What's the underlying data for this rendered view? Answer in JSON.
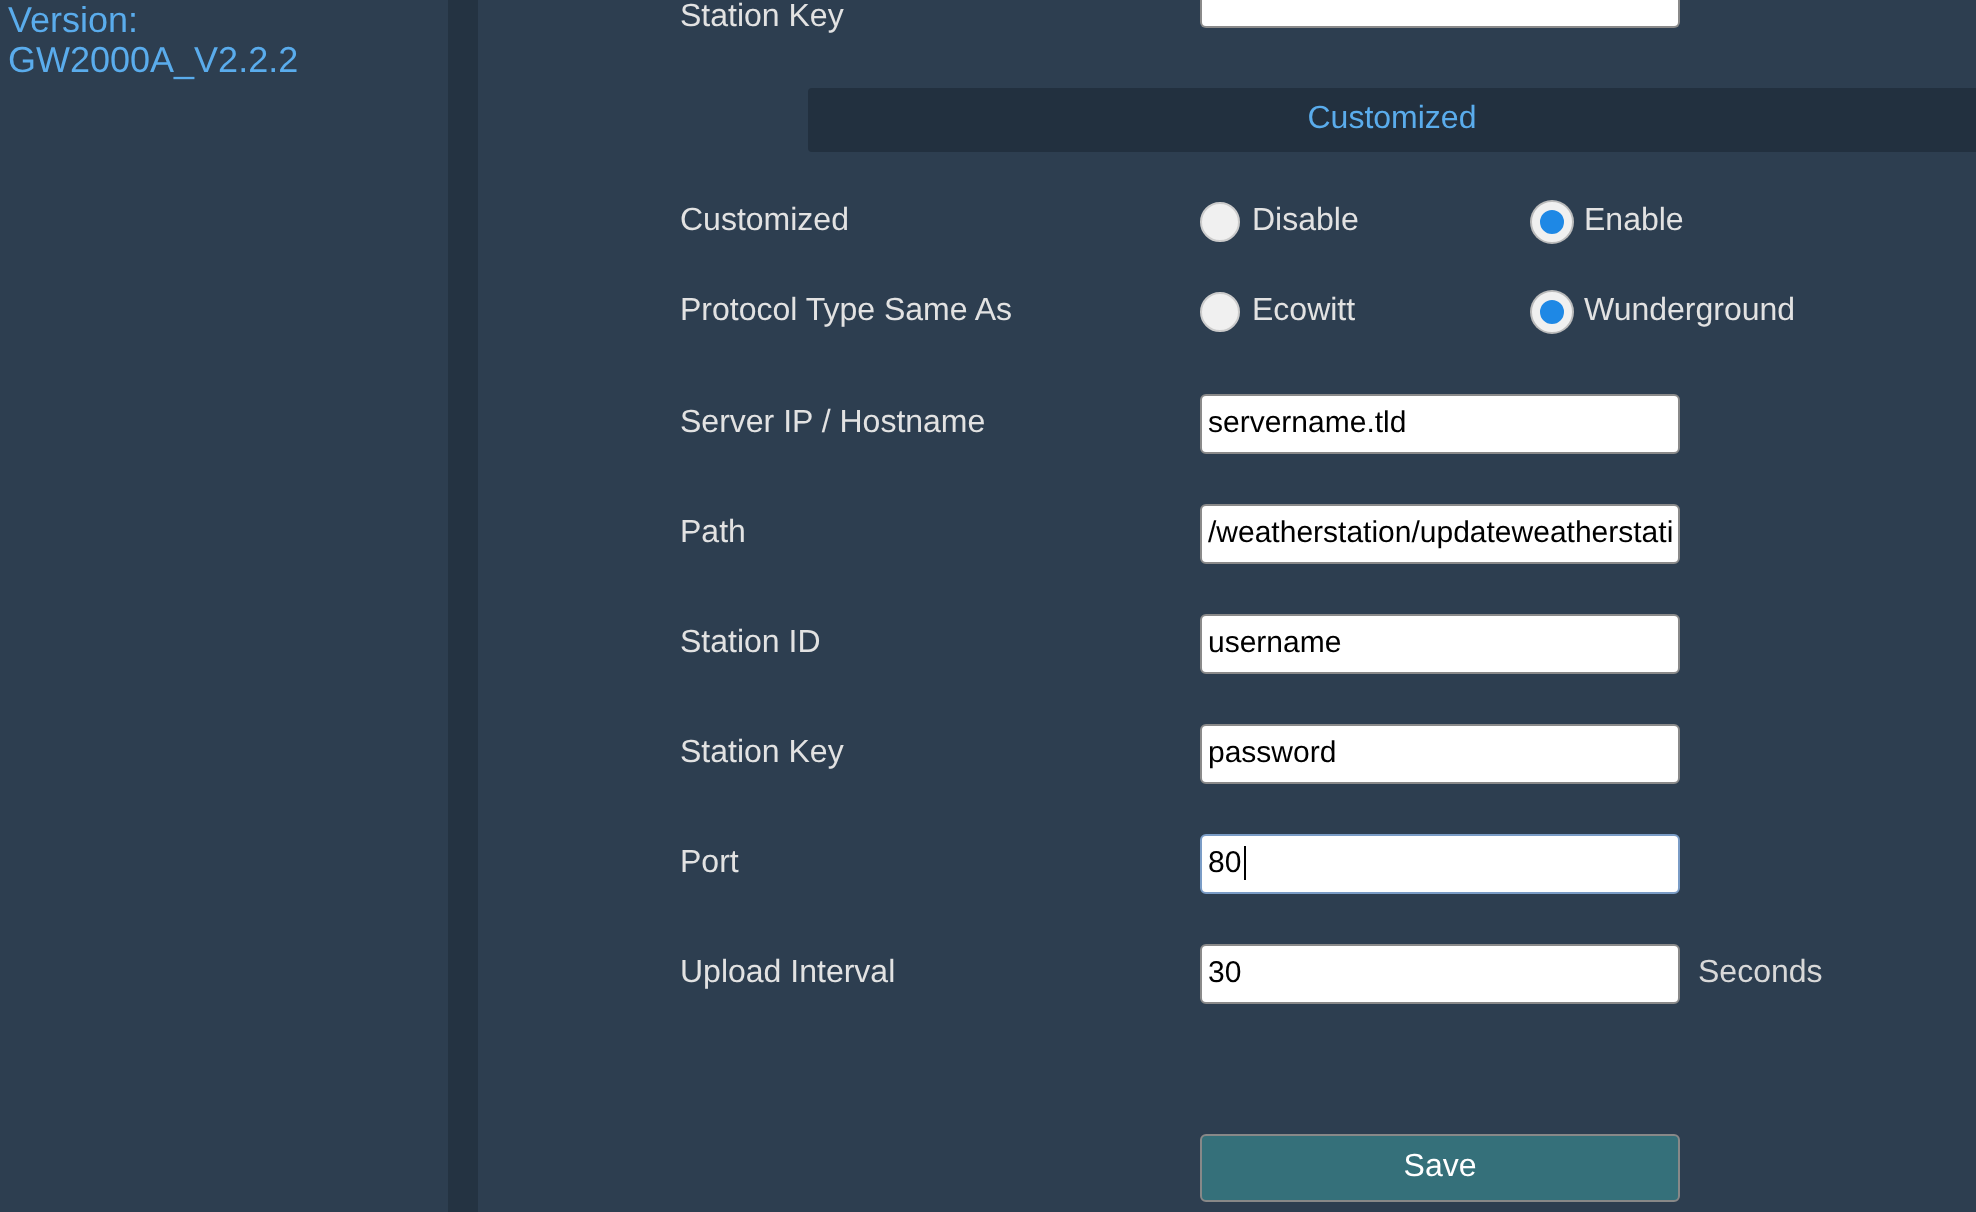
{
  "sidebar": {
    "version_label": "Version:",
    "version_value": "GW2000A_V2.2.2"
  },
  "top_row": {
    "label": "Station Key"
  },
  "section": {
    "title": "Customized"
  },
  "radio_groups": [
    {
      "label": "Customized",
      "options": [
        {
          "label": "Disable",
          "selected": false
        },
        {
          "label": "Enable",
          "selected": true
        }
      ]
    },
    {
      "label": "Protocol Type Same As",
      "options": [
        {
          "label": "Ecowitt",
          "selected": false
        },
        {
          "label": "Wunderground",
          "selected": true
        }
      ]
    }
  ],
  "fields": [
    {
      "label": "Server IP / Hostname",
      "value": "servername.tld",
      "focused": false
    },
    {
      "label": "Path",
      "value": "/weatherstation/updateweatherstati",
      "focused": false
    },
    {
      "label": "Station ID",
      "value": "username",
      "focused": false
    },
    {
      "label": "Station Key",
      "value": "password",
      "focused": false
    },
    {
      "label": "Port",
      "value": "80",
      "focused": true
    },
    {
      "label": "Upload Interval",
      "value": "30",
      "focused": false,
      "unit": "Seconds"
    }
  ],
  "save_button": "Save"
}
